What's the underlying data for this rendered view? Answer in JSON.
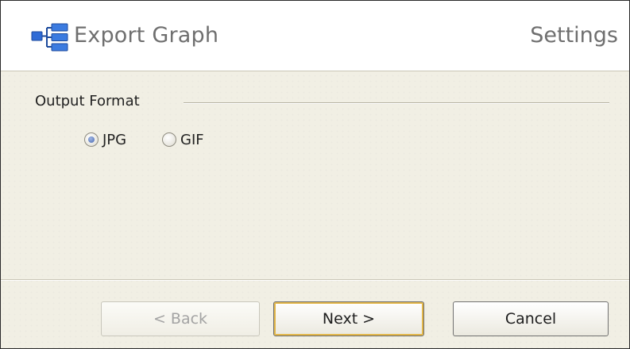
{
  "header": {
    "title": "Export Graph",
    "page_name": "Settings",
    "icon": "export-graph-icon"
  },
  "output_format": {
    "group_label": "Output Format",
    "options": [
      {
        "label": "JPG",
        "selected": true
      },
      {
        "label": "GIF",
        "selected": false
      }
    ]
  },
  "buttons": {
    "back_label": "< Back",
    "back_enabled": false,
    "next_label": "Next >",
    "cancel_label": "Cancel"
  },
  "colors": {
    "background": "#f1efe4",
    "header_background": "#ffffff",
    "icon_blue": "#2f6bd6",
    "default_button_focus": "#e3b74a"
  }
}
